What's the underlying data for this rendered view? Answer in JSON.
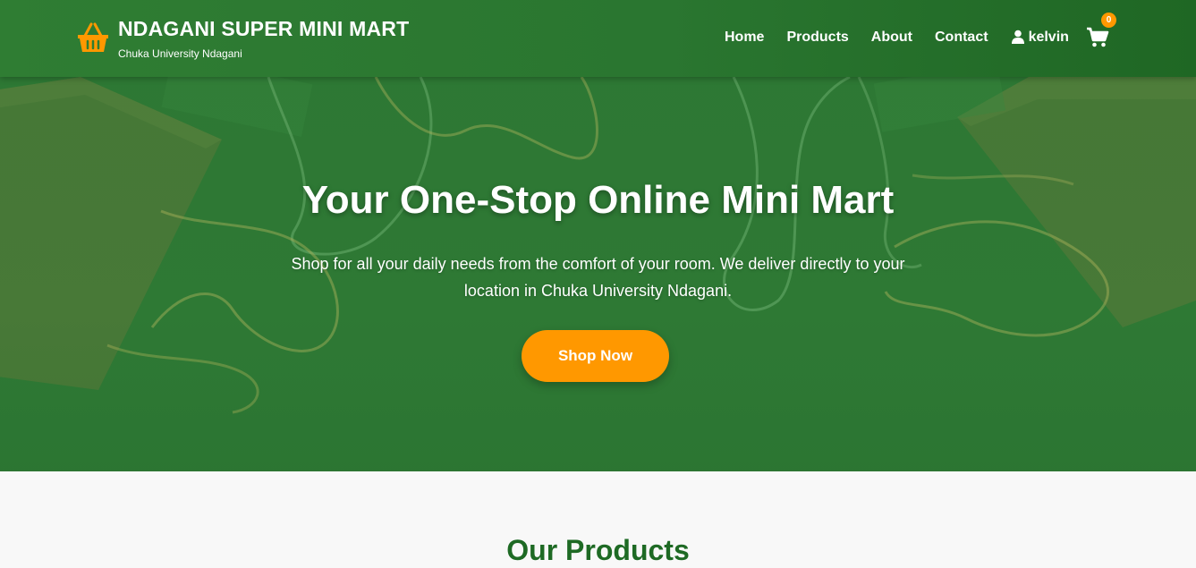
{
  "header": {
    "brand_title": "NDAGANI SUPER MINI MART",
    "brand_subtitle": "Chuka University Ndagani",
    "logo_icon": "shopping-basket-icon",
    "nav": [
      "Home",
      "Products",
      "About",
      "Contact"
    ],
    "user": {
      "icon": "user-icon",
      "name": "kelvin"
    },
    "cart": {
      "icon": "shopping-cart-icon",
      "count": "0"
    }
  },
  "hero": {
    "title": "Your One-Stop Online Mini Mart",
    "text": "Shop for all your daily needs from the comfort of your room. We deliver directly to your location in Chuka University Ndagani.",
    "button_label": "Shop Now"
  },
  "products": {
    "title": "Our Products"
  },
  "colors": {
    "header_green": "#2e7d32",
    "hero_green": "#2e7a34",
    "accent_orange": "#ff9800",
    "heading_green": "#1e6a24"
  }
}
